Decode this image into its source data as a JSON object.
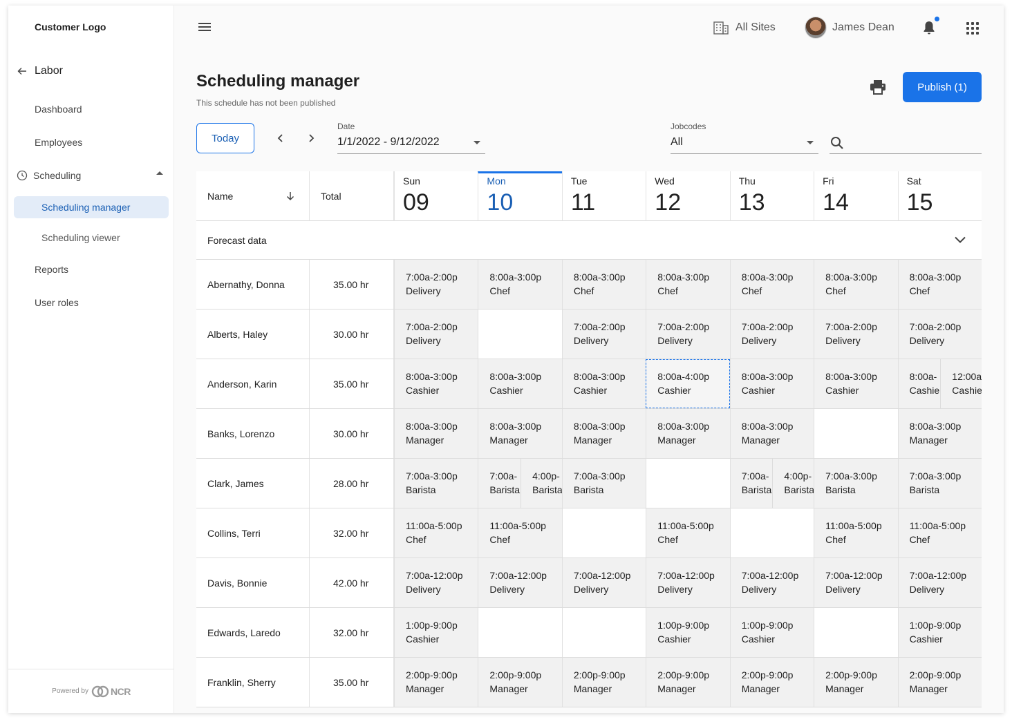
{
  "sidebar": {
    "logo": "Customer Logo",
    "back_label": "Labor",
    "items": [
      "Dashboard",
      "Employees"
    ],
    "group_label": "Scheduling",
    "sub_items": [
      "Scheduling manager",
      "Scheduling viewer"
    ],
    "bottom_items": [
      "Reports",
      "User roles"
    ],
    "powered_by": "Powered by",
    "brand": "NCR"
  },
  "topbar": {
    "sites_label": "All Sites",
    "user_name": "James Dean",
    "notification_dot_color": "#1a73e8"
  },
  "page": {
    "title": "Scheduling manager",
    "subtitle": "This schedule has not been published",
    "publish_label": "Publish (1)",
    "today_label": "Today",
    "date_label": "Date",
    "date_value": "1/1/2022 - 9/12/2022",
    "jobcodes_label": "Jobcodes",
    "jobcodes_value": "All",
    "accent_color": "#1a73e8"
  },
  "grid": {
    "name_header": "Name",
    "total_header": "Total",
    "forecast_label": "Forecast data",
    "days": [
      {
        "name": "Sun",
        "date": "09"
      },
      {
        "name": "Mon",
        "date": "10"
      },
      {
        "name": "Tue",
        "date": "11"
      },
      {
        "name": "Wed",
        "date": "12"
      },
      {
        "name": "Thu",
        "date": "13"
      },
      {
        "name": "Fri",
        "date": "14"
      },
      {
        "name": "Sat",
        "date": "15"
      }
    ],
    "today_index": 1,
    "rows": [
      {
        "name": "Abernathy, Donna",
        "total": "35.00 hr",
        "shifts": [
          [
            [
              "7:00a-2:00p",
              "Delivery"
            ]
          ],
          [
            [
              "8:00a-3:00p",
              "Chef"
            ]
          ],
          [
            [
              "8:00a-3:00p",
              "Chef"
            ]
          ],
          [
            [
              "8:00a-3:00p",
              "Chef"
            ]
          ],
          [
            [
              "8:00a-3:00p",
              "Chef"
            ]
          ],
          [
            [
              "8:00a-3:00p",
              "Chef"
            ]
          ],
          [
            [
              "8:00a-3:00p",
              "Chef"
            ]
          ]
        ]
      },
      {
        "name": "Alberts, Haley",
        "total": "30.00 hr",
        "shifts": [
          [
            [
              "7:00a-2:00p",
              "Delivery"
            ]
          ],
          [],
          [
            [
              "7:00a-2:00p",
              "Delivery"
            ]
          ],
          [
            [
              "7:00a-2:00p",
              "Delivery"
            ]
          ],
          [
            [
              "7:00a-2:00p",
              "Delivery"
            ]
          ],
          [
            [
              "7:00a-2:00p",
              "Delivery"
            ]
          ],
          [
            [
              "7:00a-2:00p",
              "Delivery"
            ]
          ]
        ]
      },
      {
        "name": "Anderson, Karin",
        "total": "35.00 hr",
        "shifts": [
          [
            [
              "8:00a-3:00p",
              "Cashier"
            ]
          ],
          [
            [
              "8:00a-3:00p",
              "Cashier"
            ]
          ],
          [
            [
              "8:00a-3:00p",
              "Cashier"
            ]
          ],
          [
            [
              "8:00a-4:00p",
              "Cashier"
            ]
          ],
          [
            [
              "8:00a-3:00p",
              "Cashier"
            ]
          ],
          [
            [
              "8:00a-3:00p",
              "Cashier"
            ]
          ],
          [
            [
              "8:00a-",
              "Cashie"
            ],
            [
              "12:00a",
              "Cashie"
            ]
          ]
        ]
      },
      {
        "name": "Banks, Lorenzo",
        "total": "30.00 hr",
        "shifts": [
          [
            [
              "8:00a-3:00p",
              "Manager"
            ]
          ],
          [
            [
              "8:00a-3:00p",
              "Manager"
            ]
          ],
          [
            [
              "8:00a-3:00p",
              "Manager"
            ]
          ],
          [
            [
              "8:00a-3:00p",
              "Manager"
            ]
          ],
          [
            [
              "8:00a-3:00p",
              "Manager"
            ]
          ],
          [],
          [
            [
              "8:00a-3:00p",
              "Manager"
            ]
          ]
        ]
      },
      {
        "name": "Clark, James",
        "total": "28.00 hr",
        "shifts": [
          [
            [
              "7:00a-3:00p",
              "Barista"
            ]
          ],
          [
            [
              "7:00a-",
              "Barista"
            ],
            [
              "4:00p-",
              "Barista"
            ]
          ],
          [
            [
              "7:00a-3:00p",
              "Barista"
            ]
          ],
          [],
          [
            [
              "7:00a-",
              "Barista"
            ],
            [
              "4:00p-",
              "Barista"
            ]
          ],
          [
            [
              "7:00a-3:00p",
              "Barista"
            ]
          ],
          [
            [
              "7:00a-3:00p",
              "Barista"
            ]
          ]
        ]
      },
      {
        "name": "Collins, Terri",
        "total": "32.00 hr",
        "shifts": [
          [
            [
              "11:00a-5:00p",
              "Chef"
            ]
          ],
          [
            [
              "11:00a-5:00p",
              "Chef"
            ]
          ],
          [],
          [
            [
              "11:00a-5:00p",
              "Chef"
            ]
          ],
          [],
          [
            [
              "11:00a-5:00p",
              "Chef"
            ]
          ],
          [
            [
              "11:00a-5:00p",
              "Chef"
            ]
          ]
        ]
      },
      {
        "name": "Davis, Bonnie",
        "total": "42.00 hr",
        "shifts": [
          [
            [
              "7:00a-12:00p",
              "Delivery"
            ]
          ],
          [
            [
              "7:00a-12:00p",
              "Delivery"
            ]
          ],
          [
            [
              "7:00a-12:00p",
              "Delivery"
            ]
          ],
          [
            [
              "7:00a-12:00p",
              "Delivery"
            ]
          ],
          [
            [
              "7:00a-12:00p",
              "Delivery"
            ]
          ],
          [
            [
              "7:00a-12:00p",
              "Delivery"
            ]
          ],
          [
            [
              "7:00a-12:00p",
              "Delivery"
            ]
          ]
        ]
      },
      {
        "name": "Edwards, Laredo",
        "total": "32.00 hr",
        "shifts": [
          [
            [
              "1:00p-9:00p",
              "Cashier"
            ]
          ],
          [],
          [],
          [
            [
              "1:00p-9:00p",
              "Cashier"
            ]
          ],
          [
            [
              "1:00p-9:00p",
              "Cashier"
            ]
          ],
          [],
          [
            [
              "1:00p-9:00p",
              "Cashier"
            ]
          ]
        ]
      },
      {
        "name": "Franklin, Sherry",
        "total": "35.00 hr",
        "shifts": [
          [
            [
              "2:00p-9:00p",
              "Manager"
            ]
          ],
          [
            [
              "2:00p-9:00p",
              "Manager"
            ]
          ],
          [
            [
              "2:00p-9:00p",
              "Manager"
            ]
          ],
          [
            [
              "2:00p-9:00p",
              "Manager"
            ]
          ],
          [
            [
              "2:00p-9:00p",
              "Manager"
            ]
          ],
          [
            [
              "2:00p-9:00p",
              "Manager"
            ]
          ],
          [
            [
              "2:00p-9:00p",
              "Manager"
            ]
          ]
        ]
      }
    ],
    "selected_cell": {
      "row": 2,
      "day": 3
    }
  }
}
